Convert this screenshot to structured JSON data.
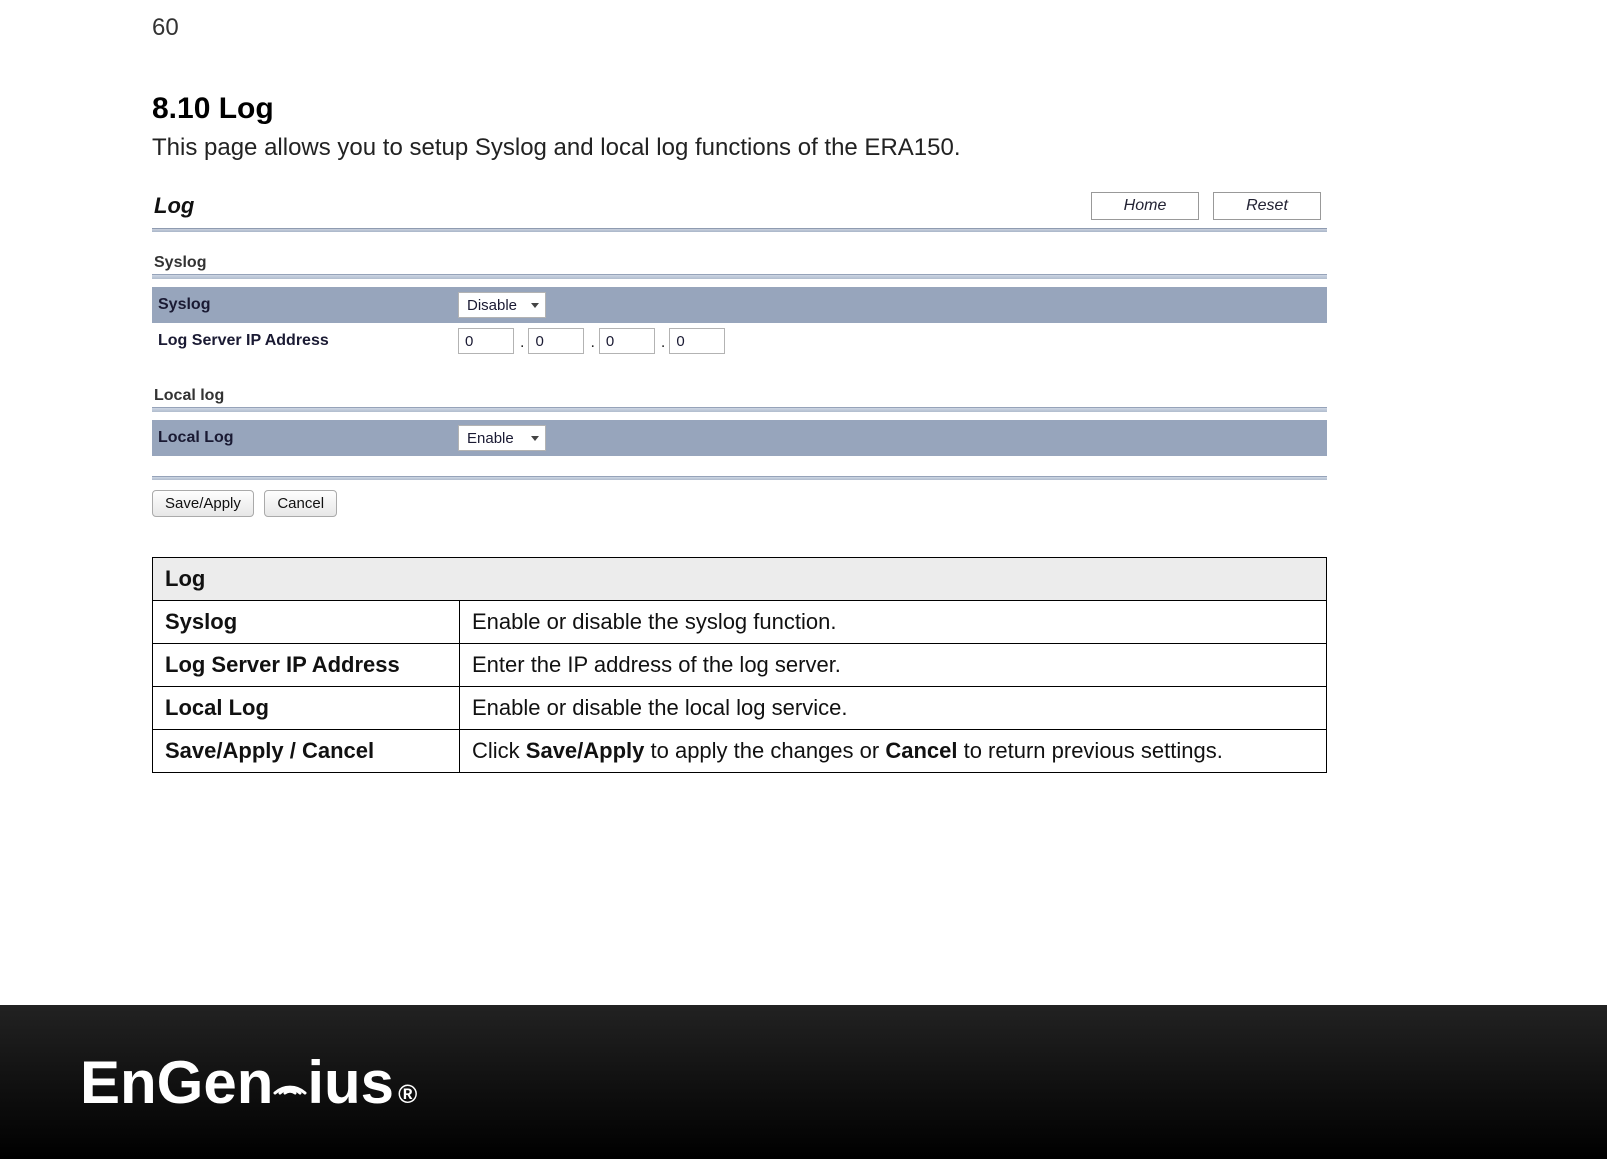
{
  "page_number": "60",
  "section": {
    "title": "8.10 Log",
    "lead": "This page allows you to setup Syslog and local log functions of the ERA150."
  },
  "panel": {
    "title": "Log",
    "home_btn": "Home",
    "reset_btn": "Reset",
    "syslog_group_title": "Syslog",
    "syslog_label": "Syslog",
    "syslog_value": "Disable",
    "logserver_label": "Log Server IP Address",
    "ip": {
      "a": "0",
      "b": "0",
      "c": "0",
      "d": "0"
    },
    "local_group_title": "Local log",
    "locallog_label": "Local Log",
    "locallog_value": "Enable",
    "save_btn": "Save/Apply",
    "cancel_btn": "Cancel"
  },
  "table": {
    "header": "Log",
    "rows": [
      {
        "key": "Syslog",
        "desc_html": "Enable or disable the syslog function."
      },
      {
        "key": "Log Server IP Address",
        "desc_html": "Enter the IP address of the log server."
      },
      {
        "key": "Local Log",
        "desc_html": "Enable or disable the local log service."
      },
      {
        "key": "Save/Apply / Cancel",
        "desc_html": "Click <b>Save/Apply</b> to apply the changes or <b>Cancel</b> to return previous settings."
      }
    ]
  },
  "footer": {
    "brand": "EnGenius",
    "reg": "®"
  }
}
